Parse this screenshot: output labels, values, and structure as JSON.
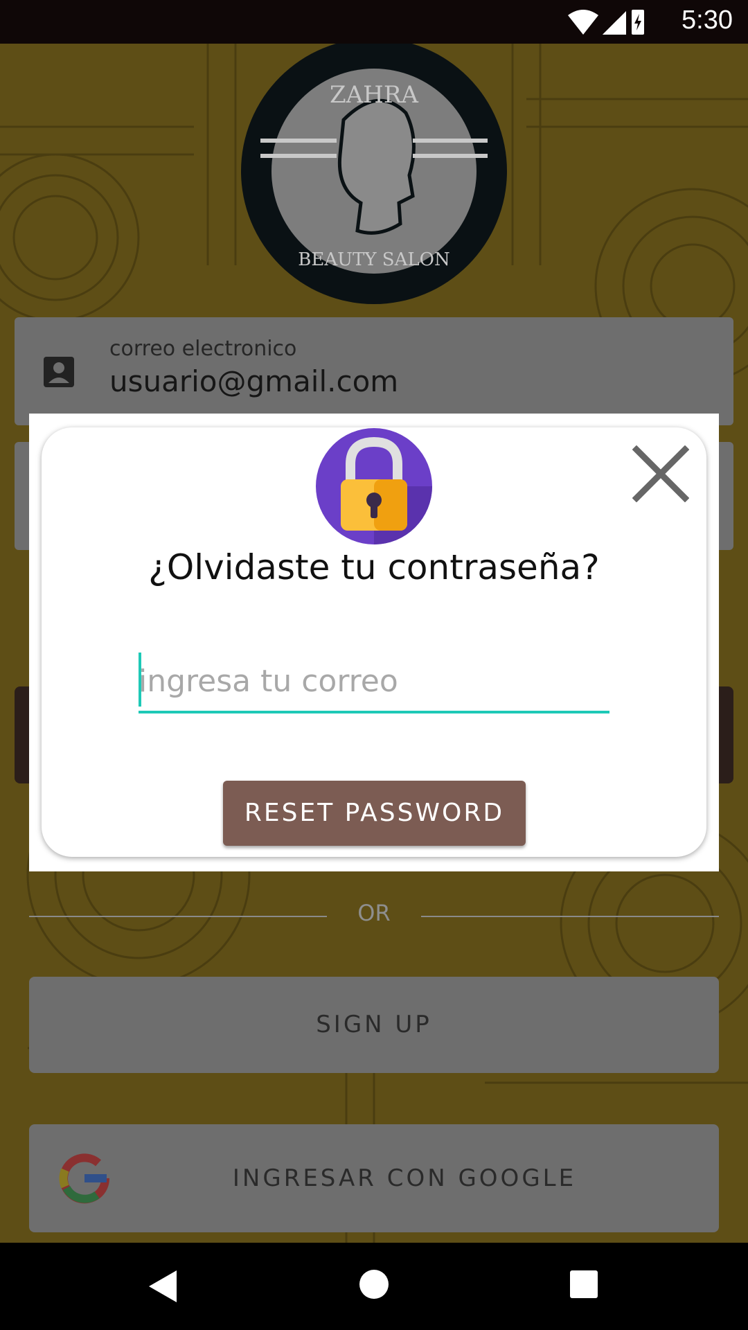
{
  "status_bar": {
    "time": "5:30",
    "icons": [
      "wifi-icon",
      "signal-icon",
      "battery-charging-icon"
    ]
  },
  "login": {
    "logo_text_top": "ZAHRA",
    "logo_text_bottom": "BEAUTY SALON",
    "email_label": "correo electronico",
    "email_value": "usuario@gmail.com",
    "or_text": "OR",
    "signup_label": "SIGN UP",
    "google_label": "INGRESAR CON GOOGLE"
  },
  "dialog": {
    "title": "¿Olvidaste tu contraseña?",
    "email_placeholder": "ingresa tu correo",
    "email_value": "",
    "reset_label": "RESET PASSWORD",
    "accent_color": "#1ec9b7",
    "button_color": "#7c5c53"
  },
  "nav": {
    "icons": [
      "back-icon",
      "home-icon",
      "recents-icon"
    ]
  }
}
